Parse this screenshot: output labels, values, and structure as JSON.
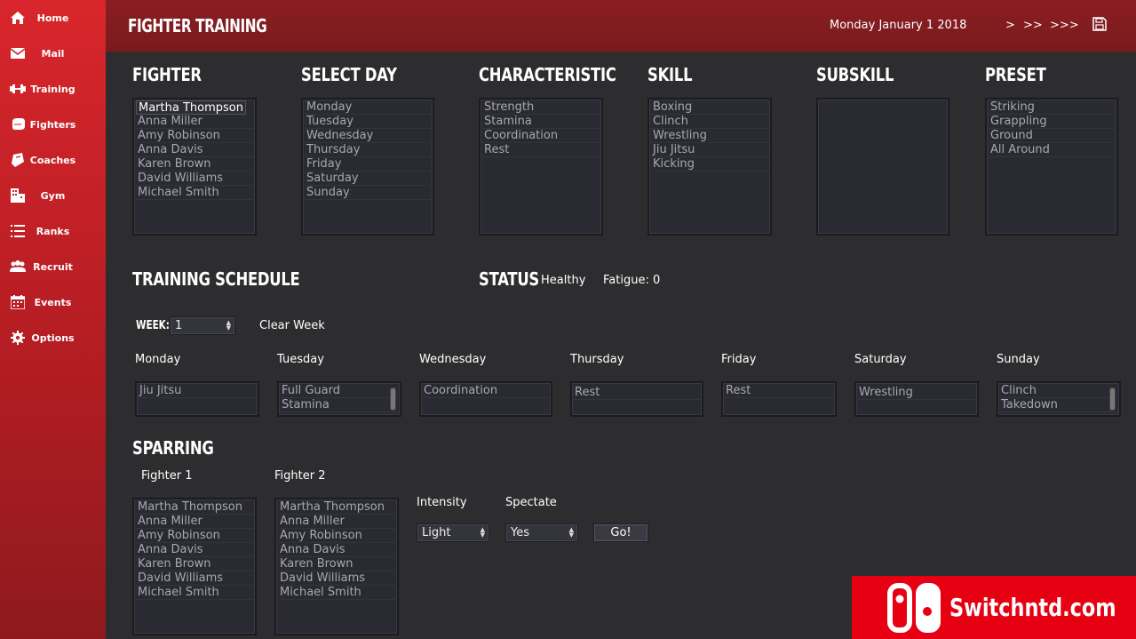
{
  "sidebar": {
    "items": [
      {
        "label": "Home",
        "icon": "home-icon"
      },
      {
        "label": "Mail",
        "icon": "mail-icon"
      },
      {
        "label": "Training",
        "icon": "dumbbell-icon"
      },
      {
        "label": "Fighters",
        "icon": "glove-icon"
      },
      {
        "label": "Coaches",
        "icon": "coach-icon"
      },
      {
        "label": "Gym",
        "icon": "building-icon"
      },
      {
        "label": "Ranks",
        "icon": "list-icon"
      },
      {
        "label": "Recruit",
        "icon": "users-icon"
      },
      {
        "label": "Events",
        "icon": "calendar-icon"
      },
      {
        "label": "Options",
        "icon": "gear-icon"
      }
    ]
  },
  "header": {
    "title": "FIGHTER TRAINING",
    "date": "Monday January 1 2018",
    "advance_1": ">",
    "advance_2": ">>",
    "advance_3": ">>>",
    "save_icon": "save-icon"
  },
  "columns": {
    "fighter": {
      "title": "FIGHTER",
      "options": [
        "Martha Thompson",
        "Anna Miller",
        "Amy Robinson",
        "Anna Davis",
        "Karen Brown",
        "David Williams",
        "Michael Smith"
      ],
      "selected": "Martha Thompson"
    },
    "day": {
      "title": "SELECT DAY",
      "options": [
        "Monday",
        "Tuesday",
        "Wednesday",
        "Thursday",
        "Friday",
        "Saturday",
        "Sunday"
      ]
    },
    "characteristic": {
      "title": "CHARACTERISTIC",
      "options": [
        "Strength",
        "Stamina",
        "Coordination",
        "Rest"
      ]
    },
    "skill": {
      "title": "SKILL",
      "options": [
        "Boxing",
        "Clinch",
        "Wrestling",
        "Jiu Jitsu",
        "Kicking"
      ]
    },
    "subskill": {
      "title": "SUBSKILL",
      "options": []
    },
    "preset": {
      "title": "PRESET",
      "options": [
        "Striking",
        "Grappling",
        "Ground",
        "All Around"
      ]
    }
  },
  "schedule": {
    "title": "TRAINING SCHEDULE",
    "week_label": "WEEK:",
    "week_value": "1",
    "clear_label": "Clear Week",
    "days": [
      {
        "name": "Monday",
        "entries": [
          "Jiu Jitsu"
        ]
      },
      {
        "name": "Tuesday",
        "entries": [
          "Full Guard",
          "Stamina"
        ]
      },
      {
        "name": "Wednesday",
        "entries": [
          "Coordination"
        ]
      },
      {
        "name": "Thursday",
        "entries": [
          "Rest"
        ]
      },
      {
        "name": "Friday",
        "entries": [
          "Rest"
        ]
      },
      {
        "name": "Saturday",
        "entries": [
          "Wrestling"
        ]
      },
      {
        "name": "Sunday",
        "entries": [
          "Clinch",
          "Takedown"
        ]
      }
    ]
  },
  "status": {
    "title": "STATUS",
    "health": "Healthy",
    "fatigue": "Fatigue: 0"
  },
  "sparring": {
    "title": "SPARRING",
    "fighter1_label": "Fighter 1",
    "fighter2_label": "Fighter 2",
    "fighter1_options": [
      "Martha Thompson",
      "Anna Miller",
      "Amy Robinson",
      "Anna Davis",
      "Karen Brown",
      "David Williams",
      "Michael Smith"
    ],
    "fighter2_options": [
      "Martha Thompson",
      "Anna Miller",
      "Amy Robinson",
      "Anna Davis",
      "Karen Brown",
      "David Williams",
      "Michael Smith"
    ],
    "intensity_label": "Intensity",
    "intensity_value": "Light",
    "spectate_label": "Spectate",
    "spectate_value": "Yes",
    "go_label": "Go!"
  },
  "watermark": {
    "text": "Switchntd.com"
  },
  "colors": {
    "sidebar": "#c8232a",
    "header": "#821c20",
    "background": "#2d2d2f",
    "watermark": "#e60012"
  }
}
